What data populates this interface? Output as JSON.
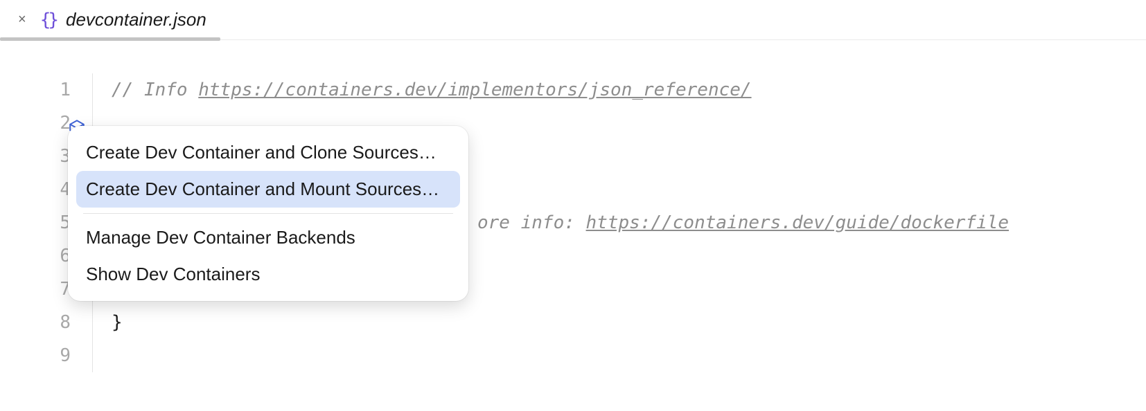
{
  "tab": {
    "title": "devcontainer.json"
  },
  "gutter": {
    "lines": [
      "1",
      "2",
      "3",
      "4",
      "5",
      "6",
      "7",
      "8",
      "9"
    ]
  },
  "code": {
    "line1_prefix": "// Info ",
    "line1_link": "https://containers.dev/implementors/json_reference/",
    "line5_prefix": "ore info: ",
    "line5_link": "https://containers.dev/guide/dockerfile",
    "brace_close": "}"
  },
  "menu": {
    "items": [
      "Create Dev Container and Clone Sources…",
      "Create Dev Container and Mount Sources…",
      "Manage Dev Container Backends",
      "Show Dev Containers"
    ]
  }
}
